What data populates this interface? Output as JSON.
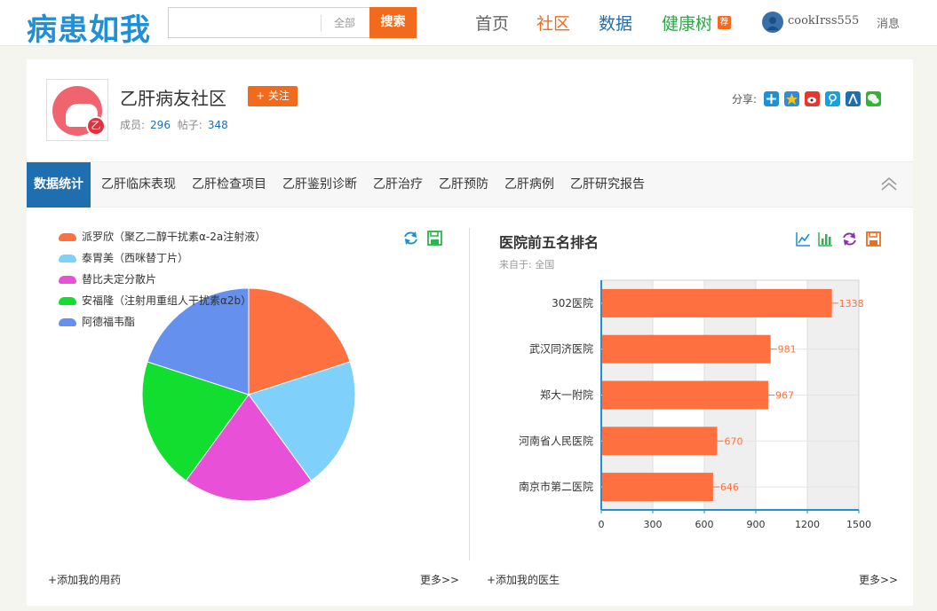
{
  "header": {
    "logo": "病患如我",
    "search": {
      "placeholder": "",
      "scope": "全部",
      "button": "搜索"
    },
    "nav": {
      "home": "首页",
      "community": "社区",
      "data": "数据",
      "health_tree": "健康树",
      "badge": "荐"
    },
    "user": {
      "name": "cookIrss555"
    },
    "messages": "消息"
  },
  "group": {
    "logo_char": "乙",
    "title": "乙肝病友社区",
    "follow": "+ 关注",
    "members_label": "成员:",
    "members": "296",
    "posts_label": "帖子:",
    "posts": "348",
    "share_label": "分享:"
  },
  "tabs": [
    "数据统计",
    "乙肝临床表现",
    "乙肝检查项目",
    "乙肝鉴别诊断",
    "乙肝治疗",
    "乙肝预防",
    "乙肝病例",
    "乙肝研究报告"
  ],
  "left_panel": {
    "add_link": "+添加我的用药",
    "more_link": "更多>>"
  },
  "right_panel": {
    "title": "医院前五名排名",
    "source": "来自于: 全国",
    "add_link": "+添加我的医生",
    "more_link": "更多>>"
  },
  "colors": {
    "accent": "#f26b1d",
    "brand_blue": "#1f6eb0",
    "green": "#29a846"
  },
  "chart_data": [
    {
      "type": "pie",
      "title": "",
      "series": [
        {
          "name": "派罗欣（聚乙二醇干扰素α-2a注射液）",
          "value": 20,
          "color": "#fe7040"
        },
        {
          "name": "泰胃美（西咪替丁片）",
          "value": 20,
          "color": "#7fd0fa"
        },
        {
          "name": "替比夫定分散片",
          "value": 20,
          "color": "#e850d8"
        },
        {
          "name": "安福隆（注射用重组人干扰素α2b）",
          "value": 20,
          "color": "#11de2f"
        },
        {
          "name": "阿德福韦酯",
          "value": 20,
          "color": "#6690ee"
        }
      ]
    },
    {
      "type": "bar",
      "title": "医院前五名排名",
      "categories": [
        "302医院",
        "武汉同济医院",
        "郑大一附院",
        "河南省人民医院",
        "南京市第二医院"
      ],
      "values": [
        1338,
        981,
        967,
        670,
        646
      ],
      "xlim": [
        0,
        1500
      ],
      "xticks": [
        0,
        300,
        600,
        900,
        1200,
        1500
      ],
      "color": "#fe7040",
      "orientation": "horizontal"
    }
  ]
}
